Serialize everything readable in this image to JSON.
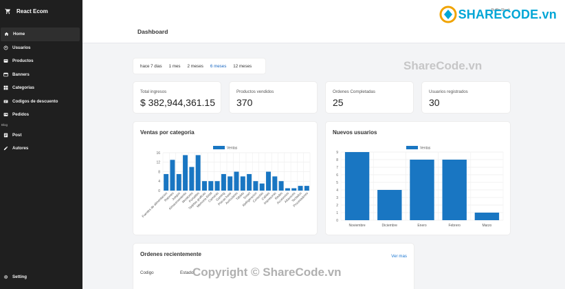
{
  "app": {
    "name": "React Ecom"
  },
  "sidebar": {
    "items": [
      {
        "label": "Home",
        "icon": "home-icon"
      },
      {
        "label": "Usuarios",
        "icon": "user-icon"
      },
      {
        "label": "Productos",
        "icon": "box-icon"
      },
      {
        "label": "Banners",
        "icon": "banner-icon"
      },
      {
        "label": "Categorias",
        "icon": "grid-icon"
      },
      {
        "label": "Codigos de descuento",
        "icon": "ticket-icon"
      },
      {
        "label": "Pedidos",
        "icon": "receipt-icon"
      }
    ],
    "section": "Blog",
    "blog_items": [
      {
        "label": "Post",
        "icon": "post-icon"
      },
      {
        "label": "Autores",
        "icon": "pencil-icon"
      }
    ],
    "setting": "Setting"
  },
  "header": {
    "title": "Dashboard"
  },
  "logo": {
    "main": "SHARECODE.vn",
    "small": "Ruffle Shark"
  },
  "watermark": {
    "mid": "ShareCode.vn",
    "bottom": "Copyright © ShareCode.vn"
  },
  "range": {
    "options": [
      "hace 7 dias",
      "1 mes",
      "2 meses",
      "6 meses",
      "12 meses"
    ],
    "selected": "6 meses"
  },
  "stats": [
    {
      "label": "Total ingresos",
      "value": "$ 382,944,361.15"
    },
    {
      "label": "Productos vendidos",
      "value": "370"
    },
    {
      "label": "Ordenes Completadas",
      "value": "25"
    },
    {
      "label": "Usuarios registrados",
      "value": "30"
    }
  ],
  "colors": {
    "bar": "#1976c2",
    "sidebar": "#1f1f1f",
    "link": "#1976d2"
  },
  "chart_data": [
    {
      "type": "bar",
      "title": "Ventas por categoria",
      "legend": "Ventas",
      "legend_position": "top",
      "ylim": [
        0,
        16
      ],
      "yticks": [
        0,
        4,
        8,
        12,
        16
      ],
      "grid": true,
      "categories": [
        "Fuentes de alimentacion",
        "Ratones",
        "Juegos",
        "Almacenamiento",
        "Monitores",
        "Portatiles",
        "Tarjetas graficas",
        "Memoria RAM",
        "Camaras",
        "Gaming",
        "Placas base",
        "Auriculares",
        "Tablets",
        "Smart",
        "Refrigeracion",
        "Consolas",
        "Cables",
        "Impresoras",
        "Redes",
        "Accesorios",
        "Altavoces",
        "Teclados",
        "Procesadores"
      ],
      "values": [
        7,
        13,
        7,
        15,
        10,
        15,
        4,
        4,
        4,
        7,
        6,
        8,
        6,
        7,
        4,
        3,
        8,
        6,
        4,
        1,
        1,
        2,
        2
      ]
    },
    {
      "type": "bar",
      "title": "Nuevos usuarios",
      "legend": "Ventas",
      "legend_position": "top",
      "ylim": [
        0,
        9
      ],
      "yticks": [
        0,
        1,
        2,
        3,
        4,
        5,
        6,
        7,
        8,
        9
      ],
      "grid": true,
      "categories": [
        "Noviembre",
        "Diciembre",
        "Enero",
        "Febrero",
        "Marzo"
      ],
      "values": [
        9,
        4,
        8,
        8,
        1
      ]
    }
  ],
  "orders": {
    "title": "Ordenes recientemente",
    "link": "Ver mas",
    "columns": [
      "Codigo",
      "Estado"
    ]
  }
}
